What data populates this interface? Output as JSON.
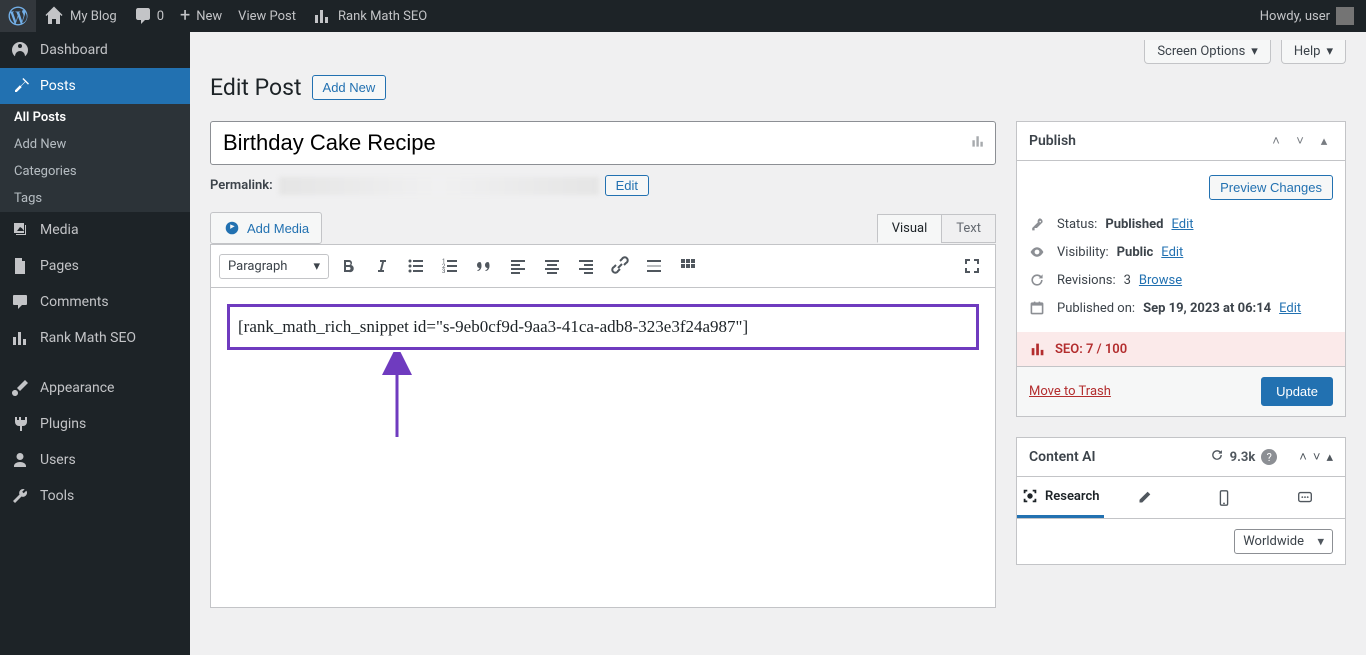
{
  "adminbar": {
    "site_name": "My Blog",
    "comments_count": "0",
    "new_label": "New",
    "view_post": "View Post",
    "rank_math": "Rank Math SEO",
    "howdy": "Howdy, user"
  },
  "sidebar": {
    "dashboard": "Dashboard",
    "posts": "Posts",
    "posts_sub": {
      "all": "All Posts",
      "add": "Add New",
      "cats": "Categories",
      "tags": "Tags"
    },
    "media": "Media",
    "pages": "Pages",
    "comments": "Comments",
    "rank_math": "Rank Math SEO",
    "appearance": "Appearance",
    "plugins": "Plugins",
    "users": "Users",
    "tools": "Tools"
  },
  "top": {
    "screen_options": "Screen Options",
    "help": "Help"
  },
  "heading": {
    "title": "Edit Post",
    "add_new": "Add New"
  },
  "editor": {
    "post_title": "Birthday Cake Recipe",
    "permalink_label": "Permalink:",
    "permalink_edit": "Edit",
    "add_media": "Add Media",
    "tabs": {
      "visual": "Visual",
      "text": "Text"
    },
    "paragraph": "Paragraph",
    "shortcode": "[rank_math_rich_snippet id=\"s-9eb0cf9d-9aa3-41ca-adb8-323e3f24a987\"]"
  },
  "publish": {
    "title": "Publish",
    "preview": "Preview Changes",
    "status_label": "Status:",
    "status_value": "Published",
    "visibility_label": "Visibility:",
    "visibility_value": "Public",
    "revisions_label": "Revisions:",
    "revisions_count": "3",
    "browse": "Browse",
    "published_label": "Published on:",
    "published_value": "Sep 19, 2023 at 06:14",
    "edit": "Edit",
    "seo_label": "SEO: 7 / 100",
    "trash": "Move to Trash",
    "update": "Update"
  },
  "content_ai": {
    "title": "Content AI",
    "credits": "9.3k",
    "tabs": {
      "research": "Research"
    },
    "worldwide": "Worldwide"
  }
}
